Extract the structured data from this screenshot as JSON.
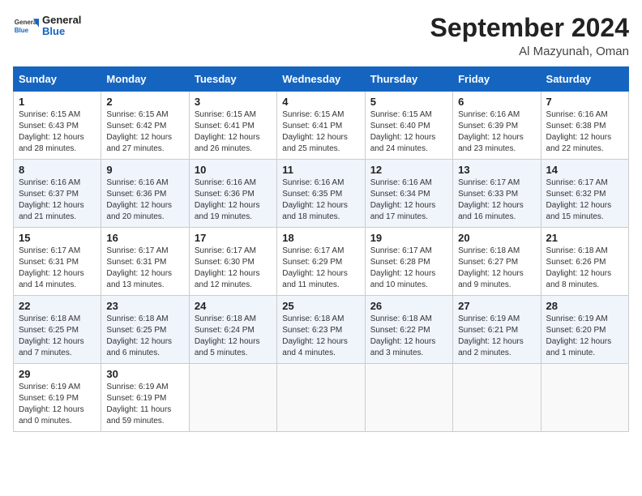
{
  "header": {
    "logo_general": "General",
    "logo_blue": "Blue",
    "month_title": "September 2024",
    "location": "Al Mazyunah, Oman"
  },
  "days_of_week": [
    "Sunday",
    "Monday",
    "Tuesday",
    "Wednesday",
    "Thursday",
    "Friday",
    "Saturday"
  ],
  "weeks": [
    [
      {
        "day": "1",
        "info": "Sunrise: 6:15 AM\nSunset: 6:43 PM\nDaylight: 12 hours\nand 28 minutes."
      },
      {
        "day": "2",
        "info": "Sunrise: 6:15 AM\nSunset: 6:42 PM\nDaylight: 12 hours\nand 27 minutes."
      },
      {
        "day": "3",
        "info": "Sunrise: 6:15 AM\nSunset: 6:41 PM\nDaylight: 12 hours\nand 26 minutes."
      },
      {
        "day": "4",
        "info": "Sunrise: 6:15 AM\nSunset: 6:41 PM\nDaylight: 12 hours\nand 25 minutes."
      },
      {
        "day": "5",
        "info": "Sunrise: 6:15 AM\nSunset: 6:40 PM\nDaylight: 12 hours\nand 24 minutes."
      },
      {
        "day": "6",
        "info": "Sunrise: 6:16 AM\nSunset: 6:39 PM\nDaylight: 12 hours\nand 23 minutes."
      },
      {
        "day": "7",
        "info": "Sunrise: 6:16 AM\nSunset: 6:38 PM\nDaylight: 12 hours\nand 22 minutes."
      }
    ],
    [
      {
        "day": "8",
        "info": "Sunrise: 6:16 AM\nSunset: 6:37 PM\nDaylight: 12 hours\nand 21 minutes."
      },
      {
        "day": "9",
        "info": "Sunrise: 6:16 AM\nSunset: 6:36 PM\nDaylight: 12 hours\nand 20 minutes."
      },
      {
        "day": "10",
        "info": "Sunrise: 6:16 AM\nSunset: 6:36 PM\nDaylight: 12 hours\nand 19 minutes."
      },
      {
        "day": "11",
        "info": "Sunrise: 6:16 AM\nSunset: 6:35 PM\nDaylight: 12 hours\nand 18 minutes."
      },
      {
        "day": "12",
        "info": "Sunrise: 6:16 AM\nSunset: 6:34 PM\nDaylight: 12 hours\nand 17 minutes."
      },
      {
        "day": "13",
        "info": "Sunrise: 6:17 AM\nSunset: 6:33 PM\nDaylight: 12 hours\nand 16 minutes."
      },
      {
        "day": "14",
        "info": "Sunrise: 6:17 AM\nSunset: 6:32 PM\nDaylight: 12 hours\nand 15 minutes."
      }
    ],
    [
      {
        "day": "15",
        "info": "Sunrise: 6:17 AM\nSunset: 6:31 PM\nDaylight: 12 hours\nand 14 minutes."
      },
      {
        "day": "16",
        "info": "Sunrise: 6:17 AM\nSunset: 6:31 PM\nDaylight: 12 hours\nand 13 minutes."
      },
      {
        "day": "17",
        "info": "Sunrise: 6:17 AM\nSunset: 6:30 PM\nDaylight: 12 hours\nand 12 minutes."
      },
      {
        "day": "18",
        "info": "Sunrise: 6:17 AM\nSunset: 6:29 PM\nDaylight: 12 hours\nand 11 minutes."
      },
      {
        "day": "19",
        "info": "Sunrise: 6:17 AM\nSunset: 6:28 PM\nDaylight: 12 hours\nand 10 minutes."
      },
      {
        "day": "20",
        "info": "Sunrise: 6:18 AM\nSunset: 6:27 PM\nDaylight: 12 hours\nand 9 minutes."
      },
      {
        "day": "21",
        "info": "Sunrise: 6:18 AM\nSunset: 6:26 PM\nDaylight: 12 hours\nand 8 minutes."
      }
    ],
    [
      {
        "day": "22",
        "info": "Sunrise: 6:18 AM\nSunset: 6:25 PM\nDaylight: 12 hours\nand 7 minutes."
      },
      {
        "day": "23",
        "info": "Sunrise: 6:18 AM\nSunset: 6:25 PM\nDaylight: 12 hours\nand 6 minutes."
      },
      {
        "day": "24",
        "info": "Sunrise: 6:18 AM\nSunset: 6:24 PM\nDaylight: 12 hours\nand 5 minutes."
      },
      {
        "day": "25",
        "info": "Sunrise: 6:18 AM\nSunset: 6:23 PM\nDaylight: 12 hours\nand 4 minutes."
      },
      {
        "day": "26",
        "info": "Sunrise: 6:18 AM\nSunset: 6:22 PM\nDaylight: 12 hours\nand 3 minutes."
      },
      {
        "day": "27",
        "info": "Sunrise: 6:19 AM\nSunset: 6:21 PM\nDaylight: 12 hours\nand 2 minutes."
      },
      {
        "day": "28",
        "info": "Sunrise: 6:19 AM\nSunset: 6:20 PM\nDaylight: 12 hours\nand 1 minute."
      }
    ],
    [
      {
        "day": "29",
        "info": "Sunrise: 6:19 AM\nSunset: 6:19 PM\nDaylight: 12 hours\nand 0 minutes."
      },
      {
        "day": "30",
        "info": "Sunrise: 6:19 AM\nSunset: 6:19 PM\nDaylight: 11 hours\nand 59 minutes."
      },
      {
        "day": "",
        "info": ""
      },
      {
        "day": "",
        "info": ""
      },
      {
        "day": "",
        "info": ""
      },
      {
        "day": "",
        "info": ""
      },
      {
        "day": "",
        "info": ""
      }
    ]
  ]
}
